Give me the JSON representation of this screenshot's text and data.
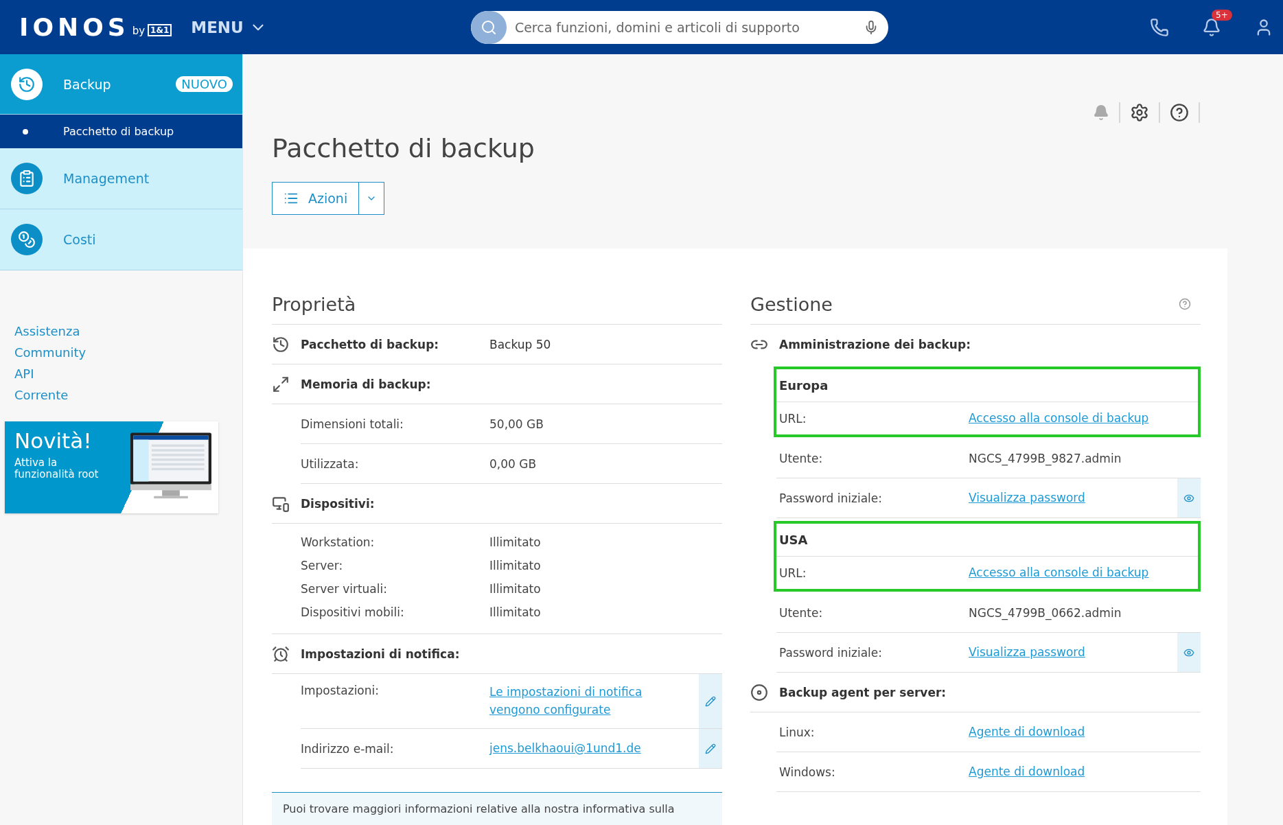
{
  "header": {
    "logo": "IONOS",
    "logo_by": "by",
    "logo_partner": "1&1",
    "menu": "MENU",
    "search": {
      "placeholder": "Cerca funzioni, domini e articoli di supporto"
    },
    "notification_badge": "5+"
  },
  "sidebar": {
    "items": [
      {
        "label": "Backup",
        "selected": true,
        "badge": "NUOVO",
        "children": [
          {
            "label": "Pacchetto di backup",
            "selected": true
          }
        ]
      },
      {
        "label": "Management",
        "selected": false
      },
      {
        "label": "Costi",
        "selected": false
      }
    ],
    "links": [
      "Assistenza",
      "Community",
      "API",
      "Corrente"
    ],
    "promo": {
      "title": "Novità!",
      "text": "Attiva la funzionalità root"
    }
  },
  "page": {
    "title": "Pacchetto di backup",
    "actions": "Azioni"
  },
  "properties": {
    "title": "Proprietà",
    "groups": [
      {
        "label": "Pacchetto di backup:",
        "value": "Backup 50",
        "kind": "rows"
      },
      {
        "label": "Memoria di backup:",
        "kind": "rows",
        "rows": [
          {
            "label": "Dimensioni totali:",
            "value": "50,00 GB",
            "kind": "text",
            "editable": false
          },
          {
            "label": "Utilizzata:",
            "value": "0,00 GB",
            "kind": "text",
            "editable": false
          }
        ]
      },
      {
        "label": "Dispositivi:",
        "kind": "list",
        "rows": [
          {
            "label": "Workstation:",
            "value": "Illimitato",
            "kind": "text",
            "editable": false
          },
          {
            "label": "Server:",
            "value": "Illimitato",
            "kind": "text",
            "editable": false
          },
          {
            "label": "Server virtuali:",
            "value": "Illimitato",
            "kind": "text",
            "editable": false
          },
          {
            "label": "Dispositivi mobili:",
            "value": "Illimitato",
            "kind": "text",
            "editable": false
          }
        ]
      },
      {
        "label": "Impostazioni di notifica:",
        "kind": "rows",
        "rows": [
          {
            "label": "Impostazioni:",
            "value": "Le impostazioni di notifica vengono configurate",
            "kind": "link",
            "editable": true
          },
          {
            "label": "Indirizzo e-mail:",
            "value": "jens.belkhaoui@1und1.de",
            "kind": "link",
            "editable": true
          }
        ]
      }
    ],
    "info": "Puoi trovare maggiori informazioni relative alla nostra informativa sulla"
  },
  "management": {
    "title": "Gestione",
    "admin_label": "Amministrazione dei backup:",
    "regions": [
      {
        "name": "Europa",
        "highlighted": true,
        "url_label": "URL:",
        "url": "Accesso alla console di backup",
        "user_label": "Utente:",
        "user": "NGCS_4799B_9827.admin",
        "password_label": "Password iniziale:",
        "password": "Visualizza password"
      },
      {
        "name": "USA",
        "highlighted": true,
        "url_label": "URL:",
        "url": "Accesso alla console di backup",
        "user_label": "Utente:",
        "user": "NGCS_4799B_0662.admin",
        "password_label": "Password iniziale:",
        "password": "Visualizza password"
      }
    ],
    "agent": {
      "label": "Backup agent per server:",
      "rows": [
        {
          "label": "Linux:",
          "link": "Agente di download"
        },
        {
          "label": "Windows:",
          "link": "Agente di download"
        }
      ]
    }
  }
}
